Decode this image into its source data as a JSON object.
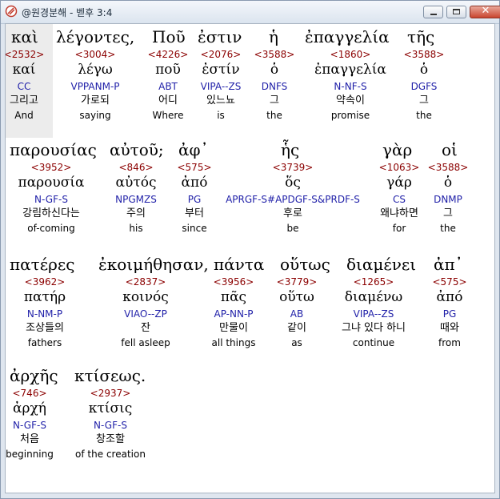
{
  "window": {
    "title": "@원경분해 - 벧후 3:4",
    "buttons": {
      "minimize": "minimize",
      "maximize": "maximize",
      "close": "✕"
    }
  },
  "rows": [
    {
      "words": [
        {
          "gk": "καὶ",
          "num": "<2532>",
          "lex": "καί",
          "parse": "CC",
          "kor": "그리고",
          "eng": "And"
        },
        {
          "gk": "λέγοντες,",
          "num": "<3004>",
          "lex": "λέγω",
          "parse": "VPPANM-P",
          "kor": "가로되",
          "eng": "saying"
        },
        {
          "gk": "Ποῦ",
          "num": "<4226>",
          "lex": "ποῦ",
          "parse": "ABT",
          "kor": "어디",
          "eng": "Where"
        },
        {
          "gk": "ἐστιν",
          "num": "<2076>",
          "lex": "ἐστίν",
          "parse": "VIPA--ZS",
          "kor": "있느뇨",
          "eng": "is"
        },
        {
          "gk": "ἡ",
          "num": "<3588>",
          "lex": "ὁ",
          "parse": "DNFS",
          "kor": "그",
          "eng": "the"
        },
        {
          "gk": "ἐπαγγελία",
          "num": "<1860>",
          "lex": "ἐπαγγελία",
          "parse": "N-NF-S",
          "kor": "약속이",
          "eng": "promise"
        },
        {
          "gk": "τῆς",
          "num": "<3588>",
          "lex": "ὁ",
          "parse": "DGFS",
          "kor": "그",
          "eng": "the"
        }
      ]
    },
    {
      "words": [
        {
          "gk": "παρουσίας",
          "num": "<3952>",
          "lex": "παρουσία",
          "parse": "N-GF-S",
          "kor": "강림하신다는",
          "eng": "of-coming"
        },
        {
          "gk": "αὐτοῦ;",
          "num": "<846>",
          "lex": "αὐτός",
          "parse": "NPGMZS",
          "kor": "주의",
          "eng": "his"
        },
        {
          "gk": "ἀφ᾽",
          "num": "<575>",
          "lex": "ἀπό",
          "parse": "PG",
          "kor": "부터",
          "eng": "since"
        },
        {
          "gk": "ἧς",
          "num": "<3739>",
          "lex": "ὅς",
          "parse": "APRGF-S#APDGF-S&PRDF-S",
          "kor": "후로",
          "eng": "be"
        },
        {
          "gk": "γὰρ",
          "num": "<1063>",
          "lex": "γάρ",
          "parse": "CS",
          "kor": "왜냐하면",
          "eng": "for"
        },
        {
          "gk": "οἱ",
          "num": "<3588>",
          "lex": "ὁ",
          "parse": "DNMP",
          "kor": "그",
          "eng": "the"
        }
      ]
    },
    {
      "words": [
        {
          "gk": "πατέρες",
          "num": "<3962>",
          "lex": "πατήρ",
          "parse": "N-NM-P",
          "kor": "조상들의",
          "eng": "fathers"
        },
        {
          "gk": "ἐκοιμήθησαν,",
          "num": "<2837>",
          "lex": "κοινός",
          "parse": "VIAO--ZP",
          "kor": "잔",
          "eng": "fell asleep"
        },
        {
          "gk": "πάντα",
          "num": "<3956>",
          "lex": "πᾶς",
          "parse": "AP-NN-P",
          "kor": "만물이",
          "eng": "all things"
        },
        {
          "gk": "οὕτως",
          "num": "<3779>",
          "lex": "οὕτω",
          "parse": "AB",
          "kor": "같이",
          "eng": "as"
        },
        {
          "gk": "διαμένει",
          "num": "<1265>",
          "lex": "διαμένω",
          "parse": "VIPA--ZS",
          "kor": "그냐 있다 하니",
          "eng": "continue"
        },
        {
          "gk": "ἀπ᾽",
          "num": "<575>",
          "lex": "ἀπό",
          "parse": "PG",
          "kor": "때와",
          "eng": "from"
        }
      ]
    },
    {
      "words": [
        {
          "gk": "ἀρχῆς",
          "num": "<746>",
          "lex": "ἀρχή",
          "parse": "N-GF-S",
          "kor": "처음",
          "eng": "beginning"
        },
        {
          "gk": "κτίσεως.",
          "num": "<2937>",
          "lex": "κτίσις",
          "parse": "N-GF-S",
          "kor": "창조할",
          "eng": "of the creation"
        }
      ]
    }
  ]
}
